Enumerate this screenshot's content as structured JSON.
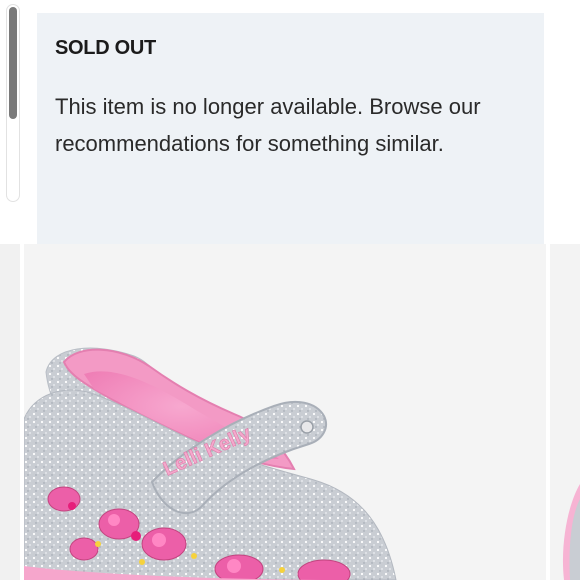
{
  "notice": {
    "title": "SOLD OUT",
    "message": "This item is no longer available. Browse our recommendations for something similar."
  },
  "recommendations": [
    {
      "product_image": "pink-glitter-mary-jane-shoe",
      "brand_mark": "Lelli Kelly"
    }
  ],
  "colors": {
    "notice_background": "#eef2f6",
    "title_text": "#1b1b1b",
    "body_text": "#2a2a2a",
    "card_background": "#f4f4f4",
    "scrollbar_thumb": "#7a7a7a"
  }
}
